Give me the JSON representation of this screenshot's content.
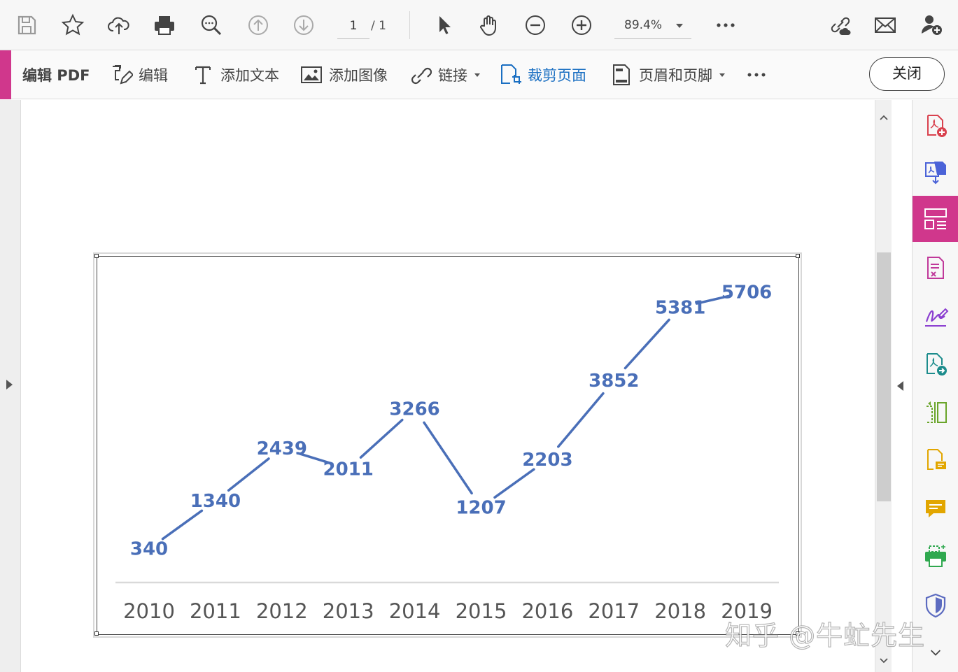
{
  "toolbar": {
    "page_current": "1",
    "page_total": "/ 1",
    "zoom": "89.4%"
  },
  "edit_toolbar": {
    "title": "编辑 PDF",
    "items": [
      {
        "label": "编辑",
        "icon": "edit-icon"
      },
      {
        "label": "添加文本",
        "icon": "text-icon"
      },
      {
        "label": "添加图像",
        "icon": "image-icon"
      },
      {
        "label": "链接",
        "icon": "link-icon"
      },
      {
        "label": "裁剪页面",
        "icon": "crop-page-icon"
      },
      {
        "label": "页眉和页脚",
        "icon": "header-footer-icon"
      }
    ],
    "close_label": "关闭"
  },
  "right_panel": {
    "tools": [
      "create-pdf-icon",
      "export-pdf-icon",
      "organize-pages-icon",
      "edit-form-icon",
      "fill-sign-icon",
      "send-review-icon",
      "compare-icon",
      "comment-doc-icon",
      "comment-icon",
      "print-production-icon",
      "protect-icon"
    ],
    "active": "organize-pages-icon"
  },
  "colors": {
    "accent": "#d0378c",
    "series": "#4a6fb8",
    "active_tool": "#1a6fc2"
  },
  "chart_data": {
    "type": "line",
    "categories": [
      "2010",
      "2011",
      "2012",
      "2013",
      "2014",
      "2015",
      "2016",
      "2017",
      "2018",
      "2019"
    ],
    "series": [
      {
        "values": [
          340,
          1340,
          2439,
          2011,
          3266,
          1207,
          2203,
          3852,
          5381,
          5706
        ]
      }
    ],
    "data_labels": true,
    "yaxis_visible": false,
    "grid": false,
    "legend": "none",
    "ylim": [
      0,
      5900
    ]
  },
  "watermark": "知乎 @牛虻先生"
}
